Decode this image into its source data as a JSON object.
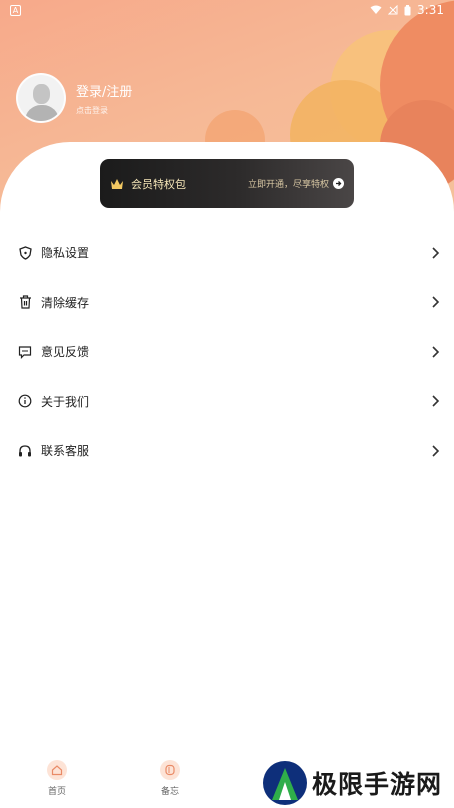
{
  "statusbar": {
    "left_badge": "A",
    "time": "3:31"
  },
  "profile": {
    "title": "登录/注册",
    "subtitle": "点击登录"
  },
  "vip": {
    "title": "会员特权包",
    "action": "立即开通，尽享特权"
  },
  "menu": {
    "items": [
      {
        "label": "隐私设置",
        "icon": "shield-icon"
      },
      {
        "label": "清除缓存",
        "icon": "trash-icon"
      },
      {
        "label": "意见反馈",
        "icon": "chat-icon"
      },
      {
        "label": "关于我们",
        "icon": "info-icon"
      },
      {
        "label": "联系客服",
        "icon": "headset-icon"
      }
    ]
  },
  "tabs": [
    {
      "label": "首页",
      "icon": "home-icon"
    },
    {
      "label": "备忘",
      "icon": "memo-icon"
    }
  ],
  "watermark": {
    "text": "极限手游网"
  },
  "colors": {
    "accent": "#f6a986",
    "vip_gold": "#f5e6b8",
    "card_dark": "#1b1b1b"
  }
}
